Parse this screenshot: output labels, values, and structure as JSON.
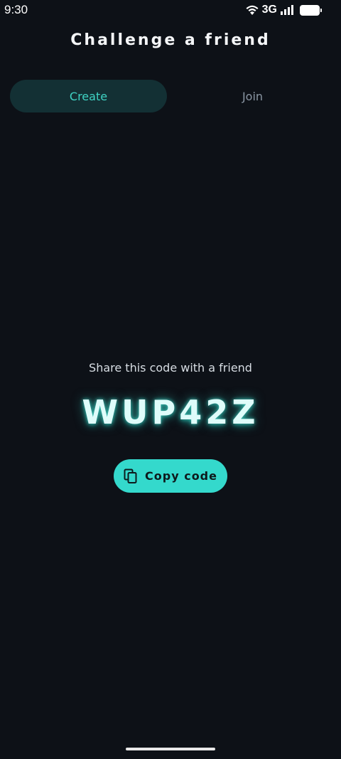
{
  "status_bar": {
    "time": "9:30",
    "network": "3G",
    "icons": [
      "wifi-icon",
      "signal-icon",
      "battery-icon"
    ]
  },
  "header": {
    "title": "Challenge a friend"
  },
  "tabs": [
    {
      "label": "Create",
      "selected": true
    },
    {
      "label": "Join",
      "selected": false
    }
  ],
  "share": {
    "label": "Share this code with a friend",
    "code": "WUP42Z",
    "copy_label": "Copy code",
    "copy_icon": "copy-icon"
  },
  "colors": {
    "background": "#0d1117",
    "accent": "#34d9cc",
    "tab_selected_bg": "#133034",
    "tab_selected_text": "#3fd3c4",
    "tab_unselected_text": "#8a96a3"
  }
}
